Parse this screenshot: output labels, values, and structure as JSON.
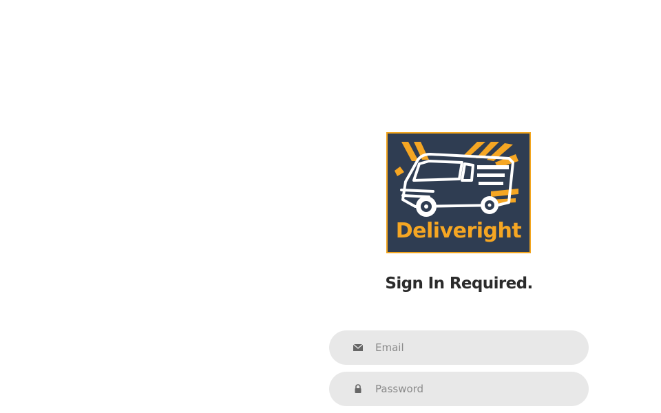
{
  "brand": {
    "logo_text": "Deliveright",
    "logo_bg": "#2f3d52",
    "logo_accent": "#f5a623"
  },
  "login": {
    "title": "Sign In Required.",
    "email": {
      "placeholder": "Email",
      "value": "",
      "icon": "envelope-icon"
    },
    "password": {
      "placeholder": "Password",
      "value": "",
      "icon": "lock-icon"
    }
  }
}
